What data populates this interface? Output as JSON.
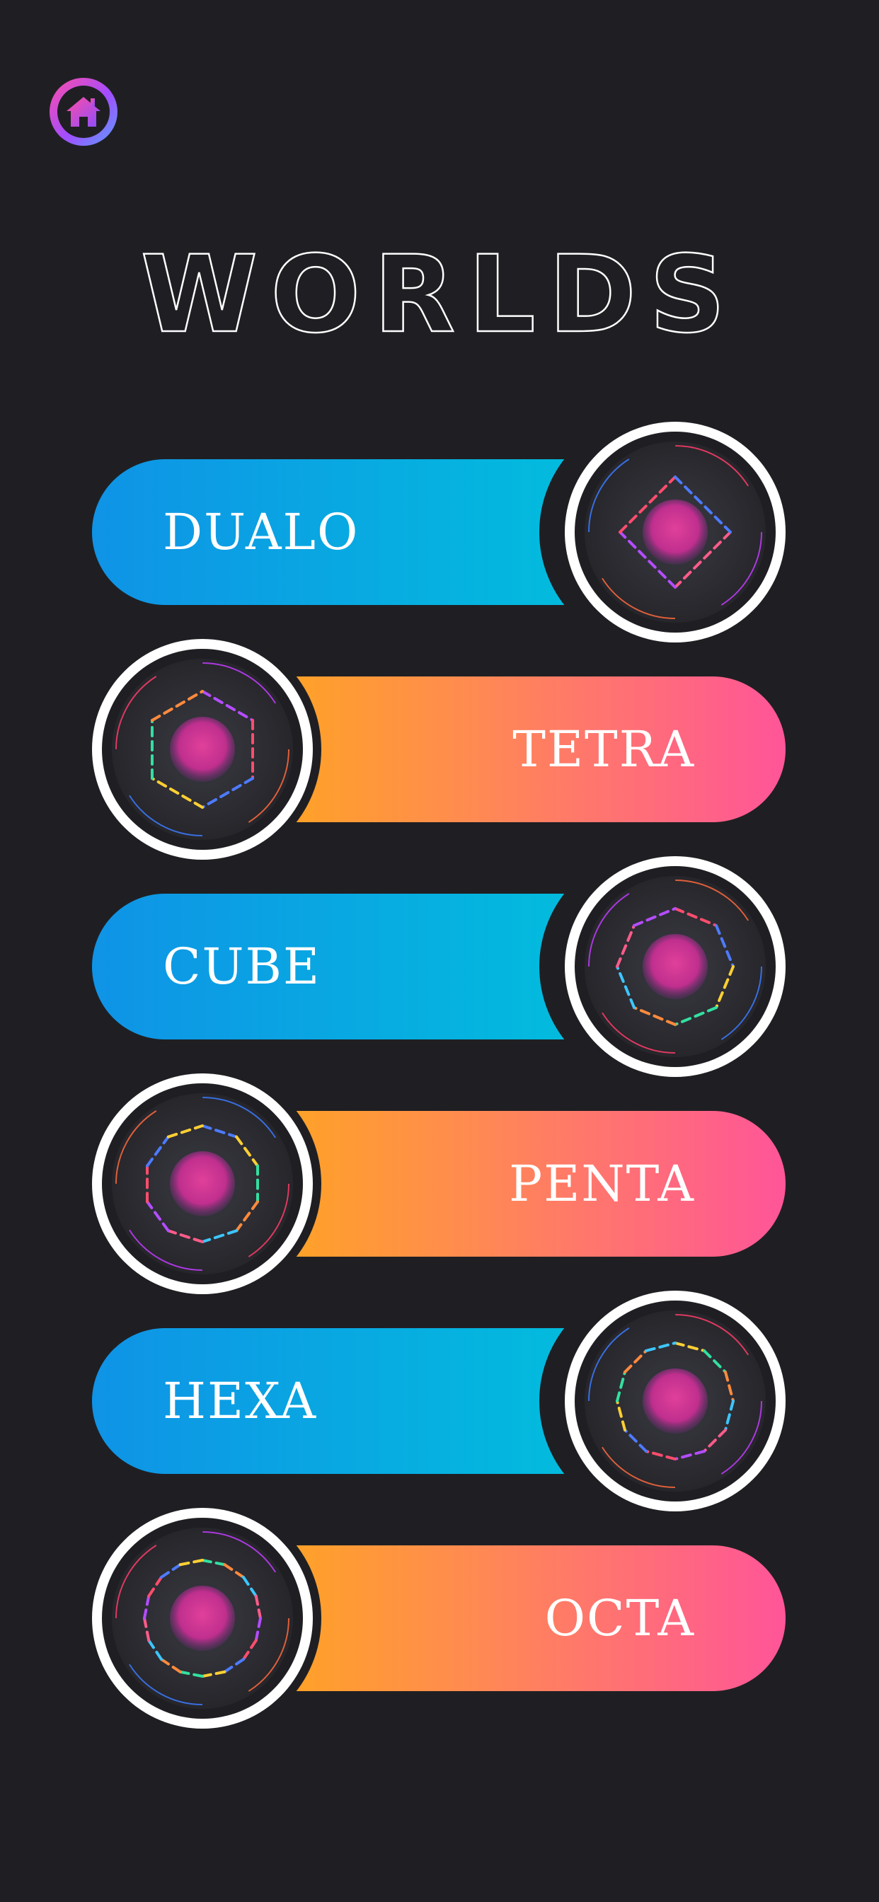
{
  "header": {
    "home_icon": "home-icon",
    "title": "WORLDS"
  },
  "worlds": [
    {
      "name": "DUALO",
      "style": "blue",
      "sides": 4,
      "badge_icon": "dualo-world-icon"
    },
    {
      "name": "TETRA",
      "style": "orange",
      "sides": 6,
      "badge_icon": "tetra-world-icon"
    },
    {
      "name": "CUBE",
      "style": "blue",
      "sides": 8,
      "badge_icon": "cube-world-icon"
    },
    {
      "name": "PENTA",
      "style": "orange",
      "sides": 10,
      "badge_icon": "penta-world-icon"
    },
    {
      "name": "HEXA",
      "style": "blue",
      "sides": 12,
      "badge_icon": "hexa-world-icon"
    },
    {
      "name": "OCTA",
      "style": "orange",
      "sides": 16,
      "badge_icon": "octa-world-icon"
    }
  ],
  "colors": {
    "background": "#1f1f23",
    "blue_start": "#0f93e6",
    "blue_end": "#00c3dc",
    "orange_start": "#ffab17",
    "orange_end": "#ff5599",
    "orb": "#d6339a"
  }
}
